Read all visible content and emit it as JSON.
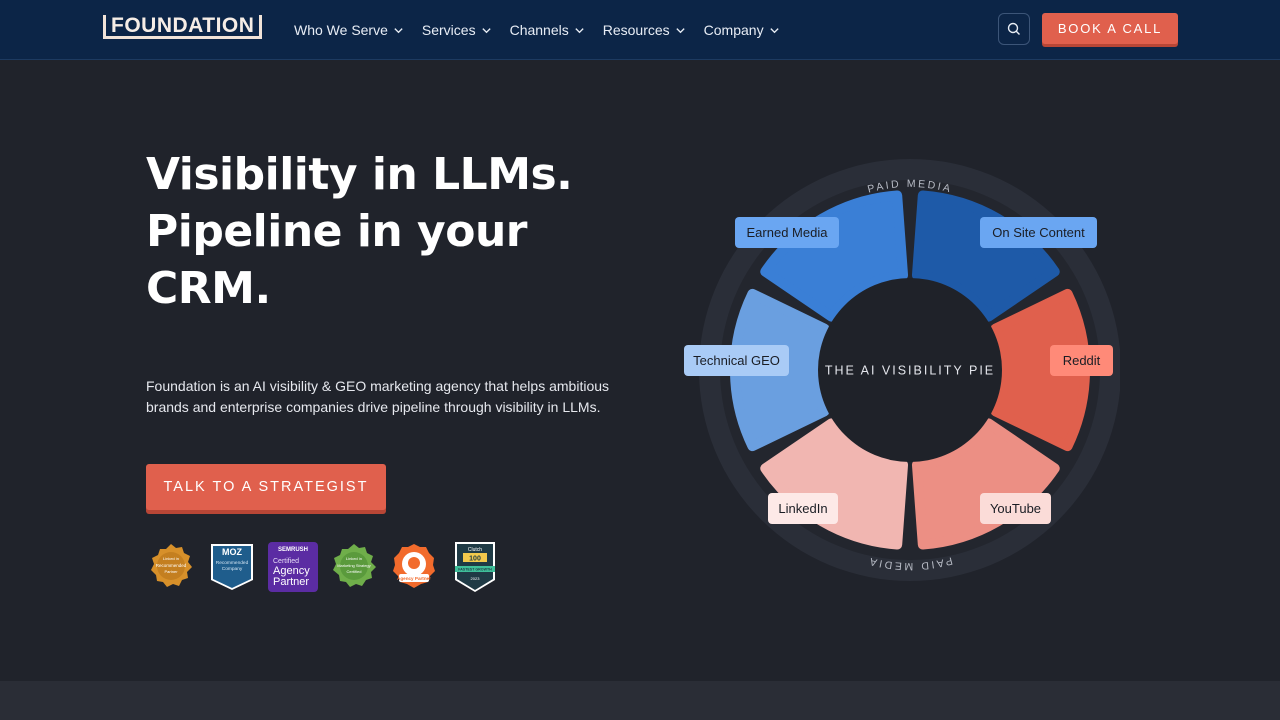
{
  "header": {
    "logo_text": "FOUNDATION",
    "nav": [
      {
        "label": "Who We Serve"
      },
      {
        "label": "Services"
      },
      {
        "label": "Channels"
      },
      {
        "label": "Resources"
      },
      {
        "label": "Company"
      }
    ],
    "book_call_label": "BOOK A CALL"
  },
  "hero": {
    "headline_lines": [
      "Visibility in LLMs.",
      "Pipeline in your",
      "CRM."
    ],
    "description": "Foundation is an AI visibility & GEO marketing agency that helps ambitious brands and enterprise companies drive pipeline through visibility in LLMs.",
    "cta_label": "TALK TO A STRATEGIST"
  },
  "badges": [
    {
      "name": "linkedin-recommended",
      "texts": [
        "Linked in",
        "Recommended",
        "Partner"
      ],
      "color": "#d7902a"
    },
    {
      "name": "moz-recommended",
      "texts": [
        "MOZ",
        "Recommended",
        "Company"
      ],
      "color": "#1f5d8c"
    },
    {
      "name": "semrush-agency-partner",
      "texts": [
        "SEMRUSH",
        "Certified",
        "Agency",
        "Partner"
      ],
      "color": "#5b2ca3"
    },
    {
      "name": "linkedin-marketing-certified",
      "texts": [
        "Linked in",
        "Marketing Strategy",
        "Certified"
      ],
      "color": "#5a9a3c"
    },
    {
      "name": "hubspot-agency-partner",
      "texts": [
        "Agency Partner"
      ],
      "color": "#f26b2c"
    },
    {
      "name": "clutch-100",
      "texts": [
        "Clutch",
        "100",
        "FASTEST GROWTH",
        "2023"
      ],
      "color": "#2d5060"
    }
  ],
  "pie": {
    "center_text": "THE AI VISIBILITY PIE",
    "outer_top": "PAID MEDIA",
    "outer_bottom": "PAID MEDIA",
    "segments": [
      {
        "label": "Earned Media",
        "color": "#3a7fd6",
        "label_bg": "#6aa6f2"
      },
      {
        "label": "On Site Content",
        "color": "#1e5aa8",
        "label_bg": "#6aa6f2"
      },
      {
        "label": "Reddit",
        "color": "#e0604d",
        "label_bg": "#ff8a78"
      },
      {
        "label": "YouTube",
        "color": "#ec8f84",
        "label_bg": "#fbdcd8"
      },
      {
        "label": "LinkedIn",
        "color": "#f1b6b1",
        "label_bg": "#fde9e7"
      },
      {
        "label": "Technical GEO",
        "color": "#6a9fe0",
        "label_bg": "#a9cbf6"
      }
    ]
  }
}
